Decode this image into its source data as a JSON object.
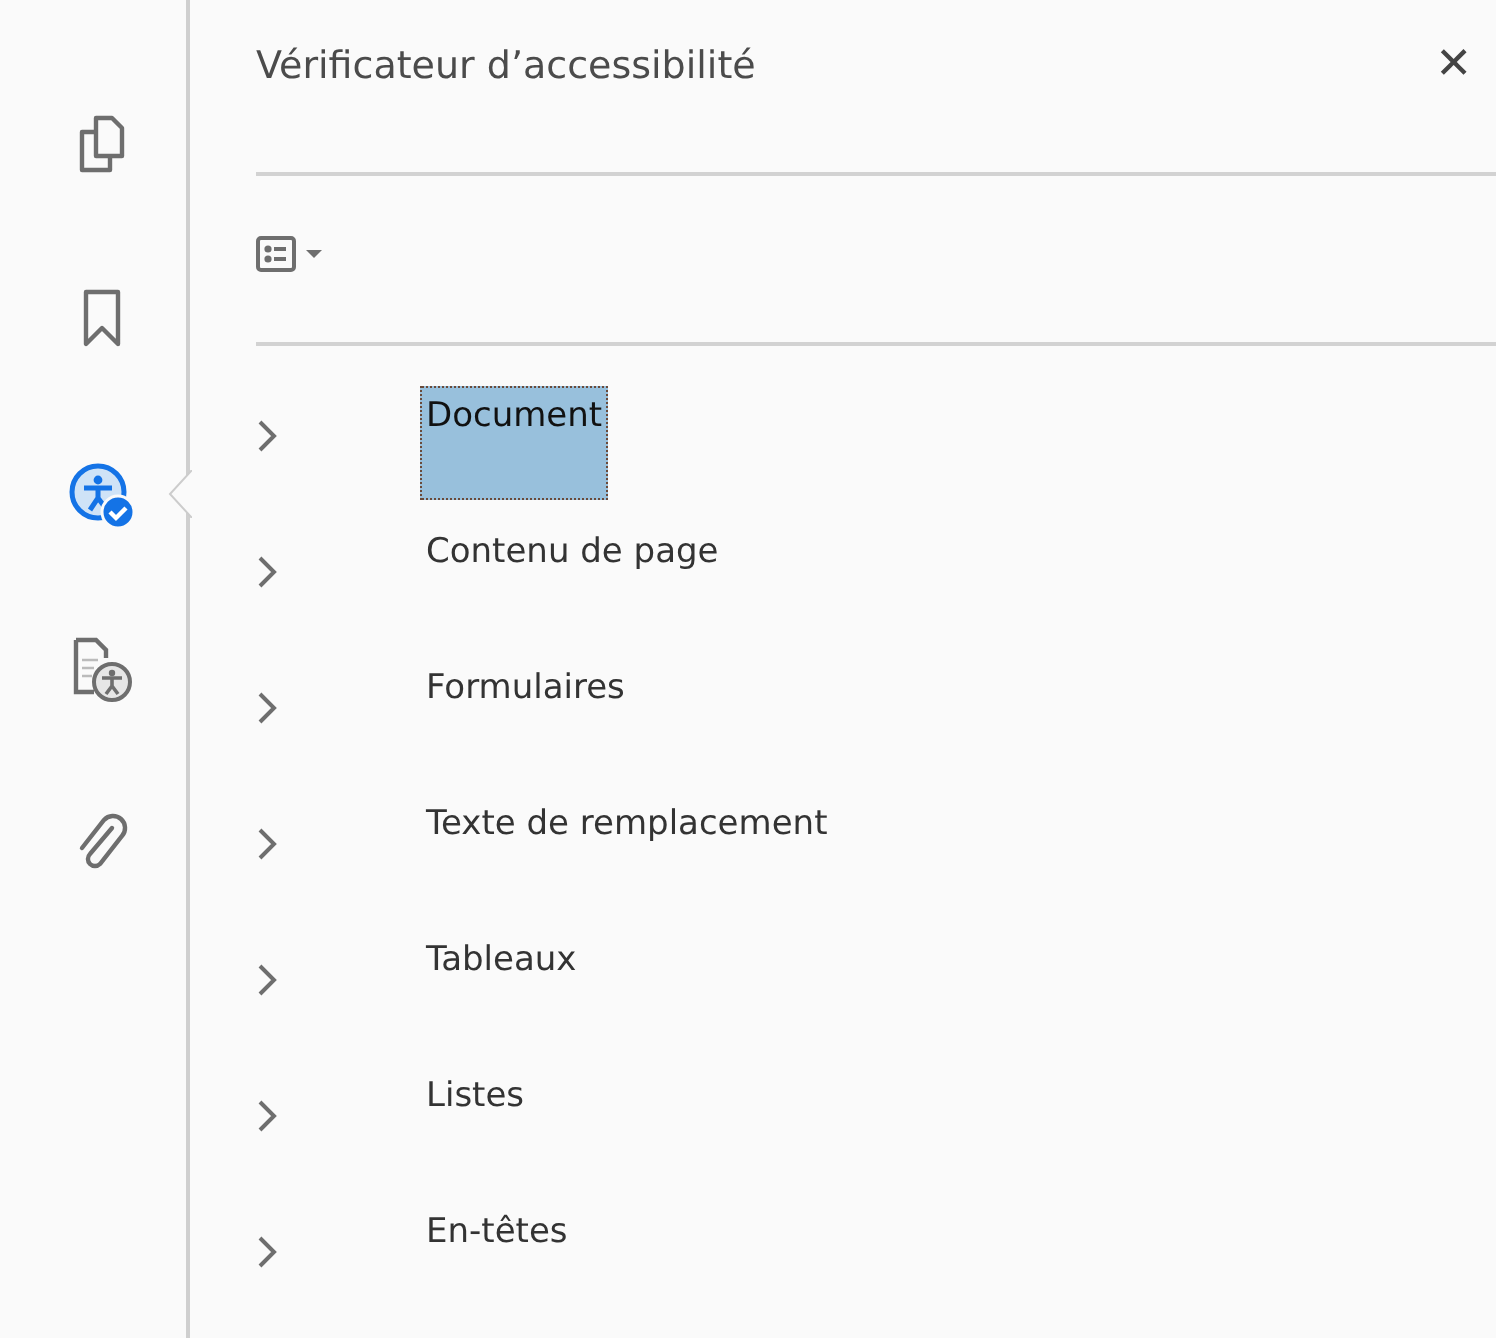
{
  "sidebar": {
    "tools": [
      {
        "kind": "pages",
        "selected": false
      },
      {
        "kind": "bookmark",
        "selected": false
      },
      {
        "kind": "accessibility-check",
        "selected": true
      },
      {
        "kind": "accessibility-doc",
        "selected": false
      },
      {
        "kind": "attachment",
        "selected": false
      }
    ]
  },
  "panel": {
    "title": "Vérificateur d’accessibilité",
    "close": "✕"
  },
  "tree": {
    "items": [
      {
        "label": "Document",
        "selected": true,
        "expanded": false
      },
      {
        "label": "Contenu de page",
        "selected": false,
        "expanded": false
      },
      {
        "label": "Formulaires",
        "selected": false,
        "expanded": false
      },
      {
        "label": "Texte de remplacement",
        "selected": false,
        "expanded": false
      },
      {
        "label": "Tableaux",
        "selected": false,
        "expanded": false
      },
      {
        "label": "Listes",
        "selected": false,
        "expanded": false
      },
      {
        "label": "En-têtes",
        "selected": false,
        "expanded": false
      }
    ]
  }
}
